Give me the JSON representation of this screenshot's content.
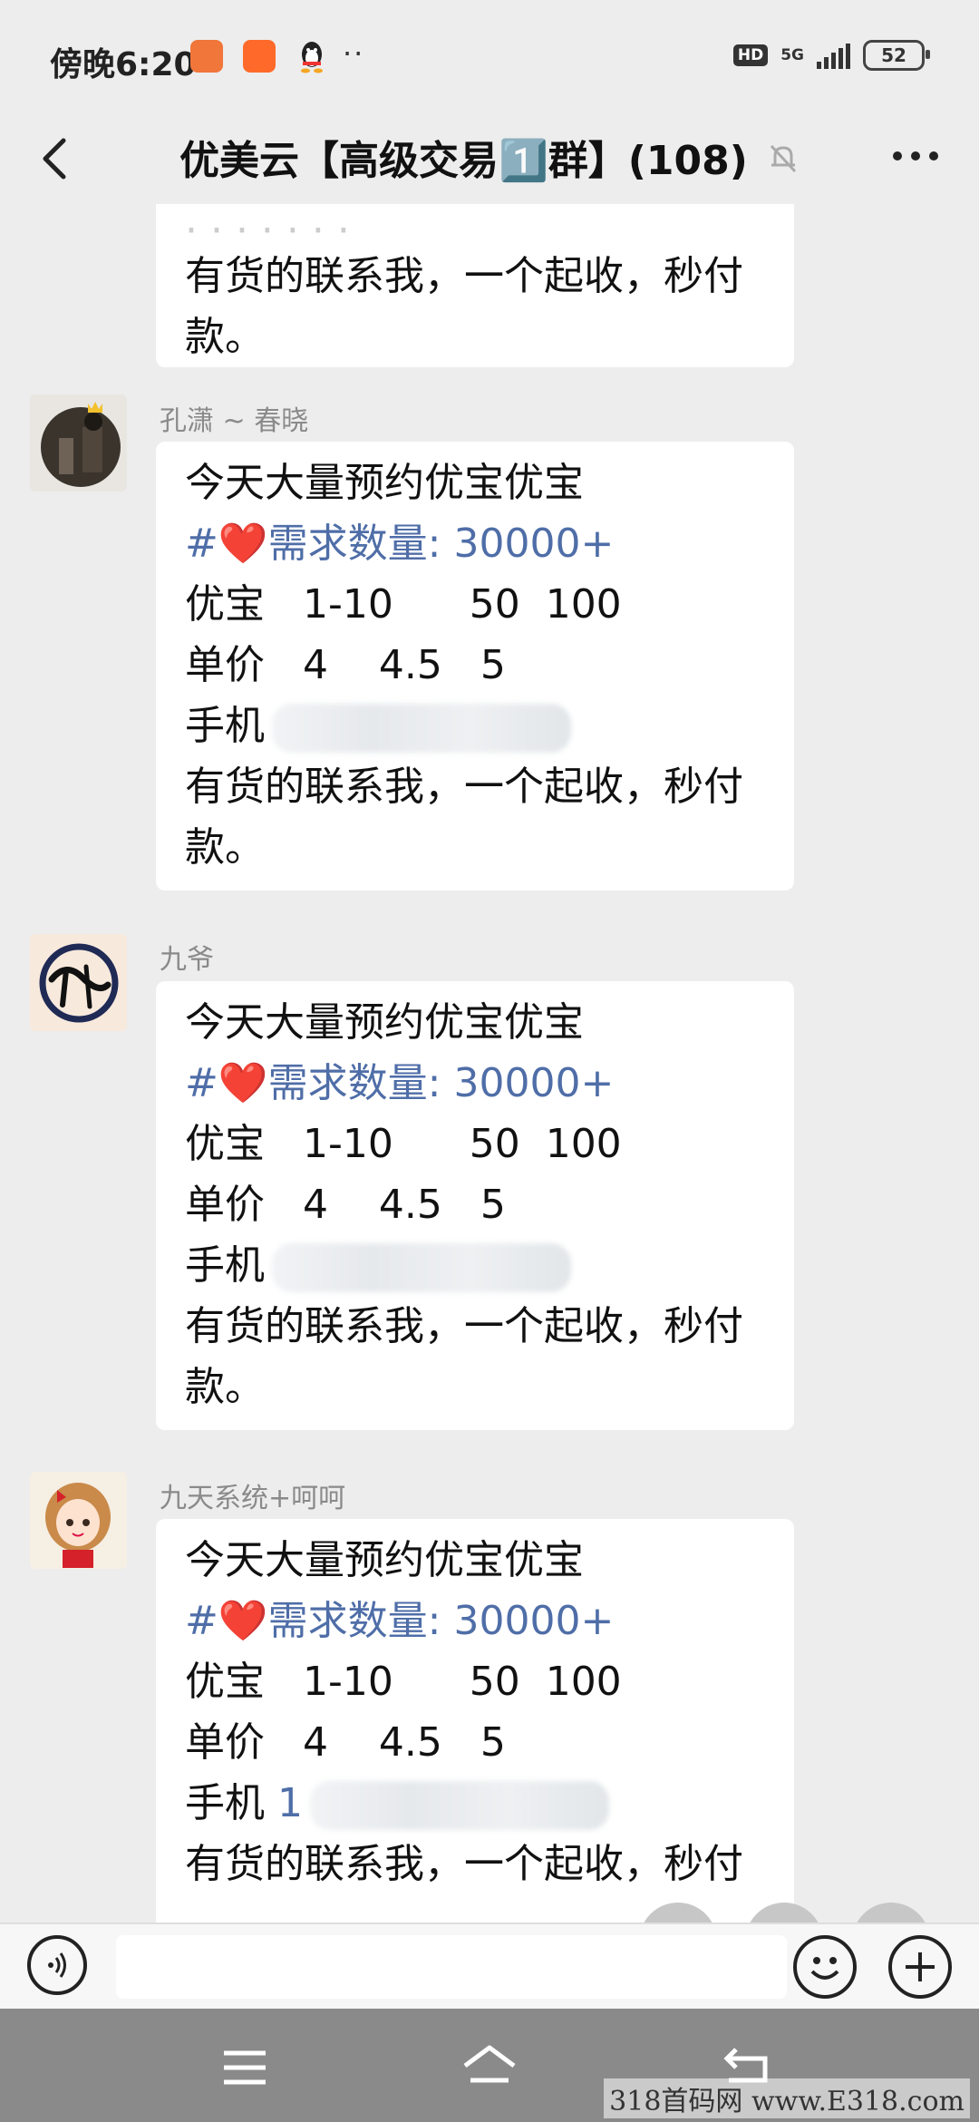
{
  "status_bar": {
    "time": "傍晚6:20",
    "dots": "··",
    "hd": "HD",
    "network": "5G",
    "battery": "52"
  },
  "header": {
    "title": "优美云【高级交易1️⃣群】(108)"
  },
  "messages": [
    {
      "partial_top": true,
      "lines": [
        "有货的联系我，一个起收，秒付",
        "款。"
      ]
    },
    {
      "sender": "孔潇 ~ 春晓",
      "avatar": "crowned-figure-avatar",
      "lines": [
        "今天大量预约优宝优宝",
        "需求数量: 30000+",
        "优宝   1-10      50  100",
        "单价   4    4.5   5",
        "手机",
        "有货的联系我，一个起收，秒付",
        "款。"
      ]
    },
    {
      "sender": "九爷",
      "avatar": "calligraphy-avatar",
      "lines": [
        "今天大量预约优宝优宝",
        "需求数量: 30000+",
        "优宝   1-10      50  100",
        "单价   4    4.5   5",
        "手机",
        "有货的联系我，一个起收，秒付",
        "款。"
      ]
    },
    {
      "sender": "九天系统+呵呵",
      "avatar": "cartoon-girl-avatar",
      "lines": [
        "今天大量预约优宝优宝",
        "需求数量: 30000+",
        "优宝   1-10      50  100",
        "单价   4    4.5   5",
        "手机",
        "有货的联系我，一个起收，秒付"
      ],
      "phone_partial": "1"
    }
  ],
  "message_prefix": {
    "hash": "#",
    "heart": "❤️"
  },
  "watermark": "318首码网 www.E318.com",
  "colors": {
    "background": "#ededed",
    "bubble": "#ffffff",
    "link_blue": "#4f6ea8",
    "heart": "#e94a6b",
    "nav_bar": "#8a8a8a"
  }
}
